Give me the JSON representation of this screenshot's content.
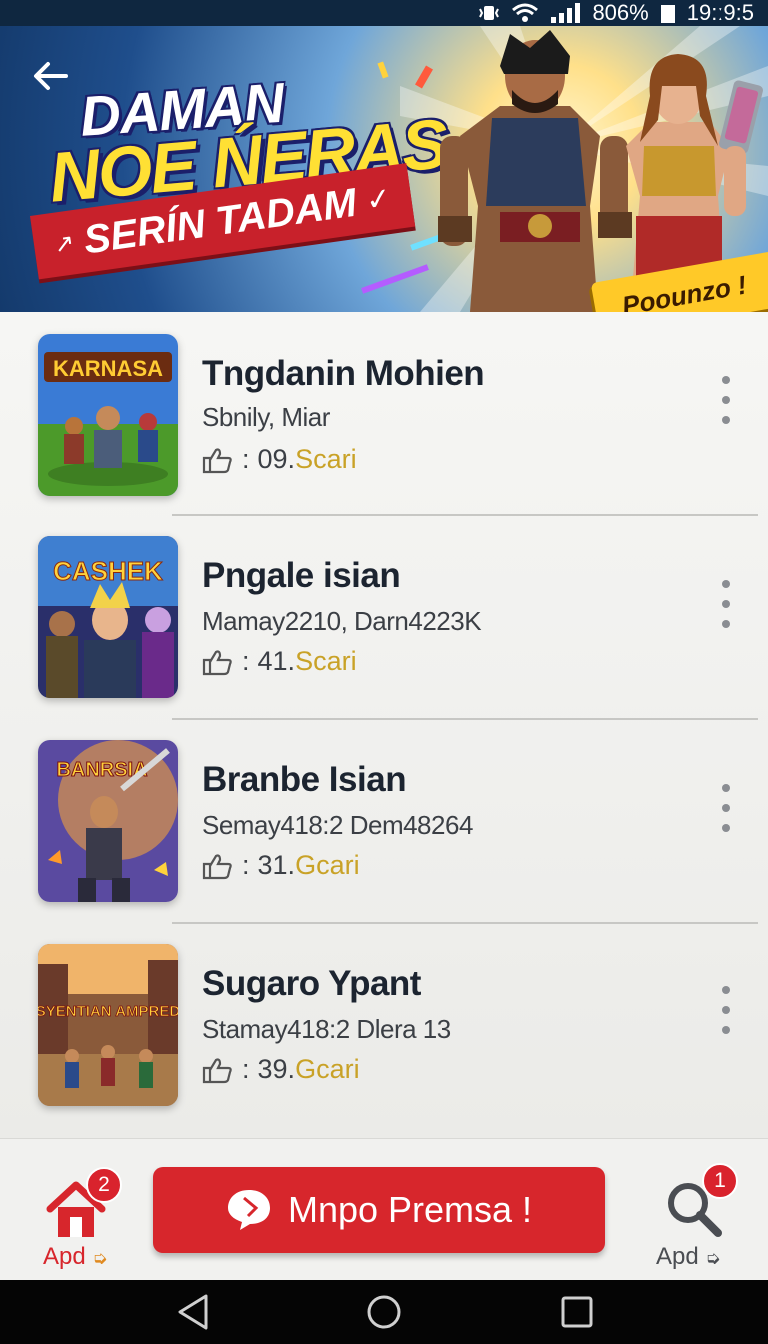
{
  "status_bar": {
    "battery": "806%",
    "time": "19:ː9:5"
  },
  "banner": {
    "line1": "DAMAN",
    "line2": "NOE ŃERAS",
    "ribbon": "SERÍN TADAM",
    "promo_badge": "Poounzo !"
  },
  "games": [
    {
      "thumb_title": "KARNASA",
      "title": "Tngdanin Mohien",
      "subtitle": "Sbnily, Miar",
      "meta_num": "09.",
      "meta_word": "Scari"
    },
    {
      "thumb_title": "CASHEK",
      "title": "Pngale isian",
      "subtitle": "Mamay2210, Darn4223K",
      "meta_num": "41.",
      "meta_word": "Scari"
    },
    {
      "thumb_title": "BANRSIA",
      "title": "Branbe Isian",
      "subtitle": "Semay418:2 Dem48264",
      "meta_num": "31.",
      "meta_word": "Gcari"
    },
    {
      "thumb_title": "SYENTIAN AMPRED",
      "title": "Sugaro Ypant",
      "subtitle": "Stamay418:2 Dlera 13",
      "meta_num": "39.",
      "meta_word": "Gcari"
    }
  ],
  "bottom_bar": {
    "left_label": "Apd",
    "left_badge": "2",
    "cta_label": "Mnpo Premsa !",
    "right_label": "Apd",
    "right_badge": "1"
  },
  "colors": {
    "accent": "#d7262c",
    "gold": "#c9a227",
    "banner_blue": "#1f4e8c"
  }
}
